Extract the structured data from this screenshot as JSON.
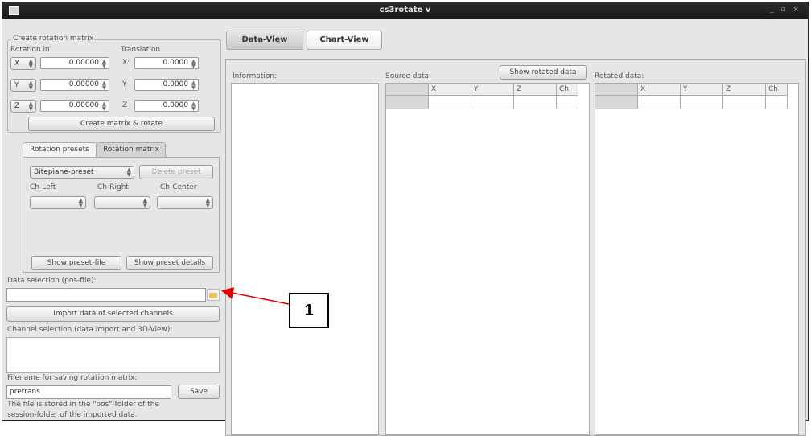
{
  "window": {
    "title": "cs3rotate v"
  },
  "rotation_group": {
    "title": "Create rotation matrix",
    "rotation_label": "Rotation in",
    "translation_label": "Translation",
    "rows": [
      {
        "axis": "X",
        "rot": "0.00000",
        "tlabel": "X:",
        "trans": "0.0000"
      },
      {
        "axis": "Y",
        "rot": "0.00000",
        "tlabel": "Y",
        "trans": "0.0000"
      },
      {
        "axis": "Z",
        "rot": "0.00000",
        "tlabel": "Z",
        "trans": "0.0000"
      }
    ],
    "create_button": "Create matrix & rotate"
  },
  "left_tabs": {
    "presets": "Rotation presets",
    "matrix": "Rotation matrix"
  },
  "presets": {
    "preset_value": "Bitepiane-preset",
    "delete_button": "Delete preset",
    "ch_left": "Ch-Left",
    "ch_right": "Ch-Right",
    "ch_center": "Ch-Center",
    "show_file_button": "Show preset-file",
    "show_details_button": "Show preset details"
  },
  "data_selection": {
    "label": "Data selection (pos-file):",
    "value": "",
    "browse_icon": "folder-icon",
    "import_button": "Import data of selected channels"
  },
  "channel_selection": {
    "label": "Channel selection (data import and 3D-View):"
  },
  "save": {
    "label": "Filename for saving rotation matrix:",
    "value": "pretrans",
    "button": "Save",
    "note_line1": "The file is stored in the \"pos\"-folder of the",
    "note_line2": "session-folder of the imported data."
  },
  "main_tabs": {
    "data_view": "Data-View",
    "chart_view": "Chart-View"
  },
  "panels": {
    "information": "Information:",
    "source": "Source data:",
    "show_rotated": "Show rotated data",
    "rotated": "Rotated data:",
    "columns": [
      "X",
      "Y",
      "Z",
      "Ch"
    ]
  },
  "annotation": {
    "number": "1",
    "color": "#e00000"
  }
}
